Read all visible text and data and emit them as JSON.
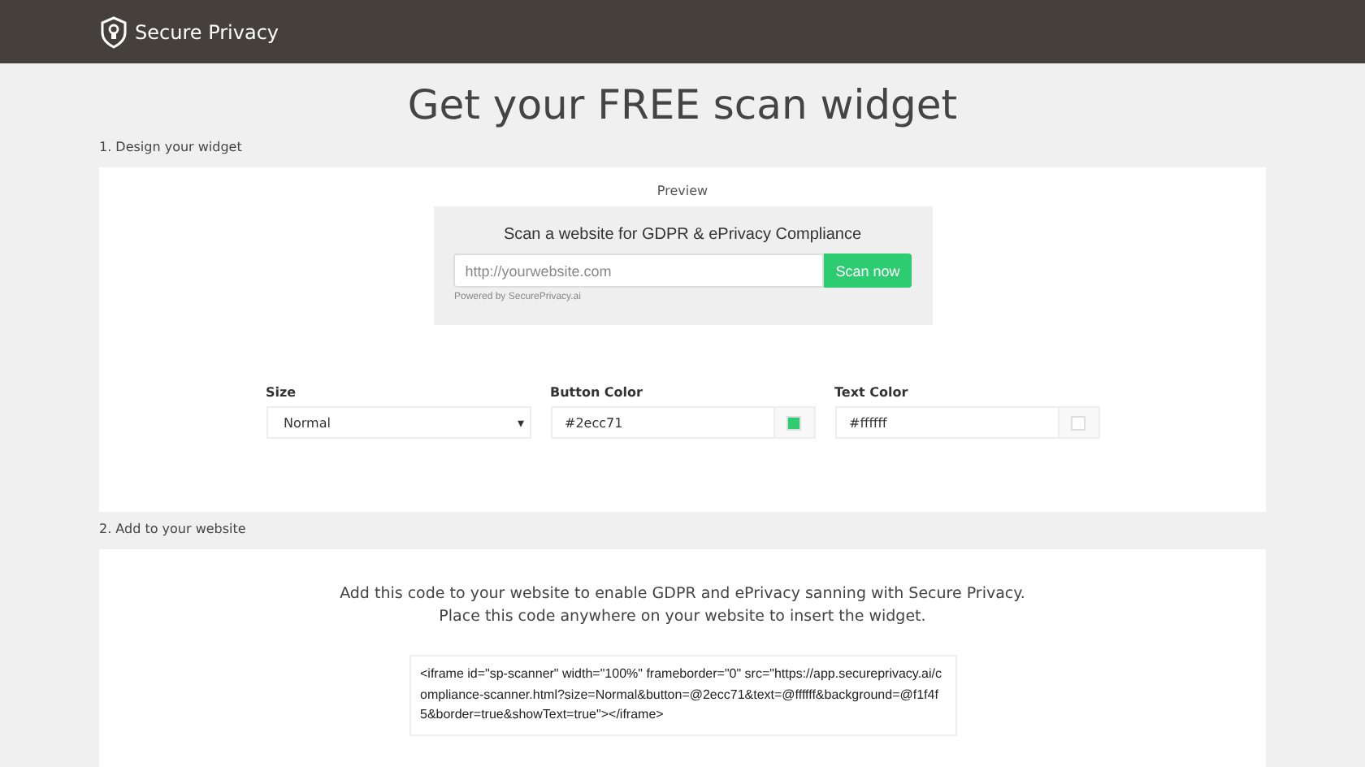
{
  "header": {
    "brand": "Secure Privacy"
  },
  "title": "Get your FREE scan widget",
  "design": {
    "heading": "1. Design your widget",
    "preview_label": "Preview",
    "preview": {
      "heading": "Scan a website for GDPR & ePrivacy Compliance",
      "placeholder": "http://yourwebsite.com",
      "button": "Scan now",
      "powered_by": "Powered by SecurePrivacy.ai"
    },
    "fields": [
      {
        "kind": "select",
        "label": "Size",
        "value": "Normal",
        "caret": "▾"
      },
      {
        "kind": "color",
        "label": "Button Color",
        "value": "#2ecc71",
        "color": "#2ecc71"
      },
      {
        "kind": "color",
        "label": "Text Color",
        "value": "#ffffff",
        "color": "#ffffff"
      }
    ]
  },
  "embed": {
    "heading": "2. Add to your website",
    "instructions": "Add this code to your website to enable GDPR and ePrivacy sanning with Secure Privacy.\nPlace this code anywhere on your website to insert the widget.",
    "code": "<iframe id=\"sp-scanner\" width=\"100%\" frameborder=\"0\" src=\"https://app.secureprivacy.ai/compliance-scanner.html?size=Normal&button=@2ecc71&text=@ffffff&background=@f1f4f5&border=true&showText=true\"></iframe>"
  }
}
